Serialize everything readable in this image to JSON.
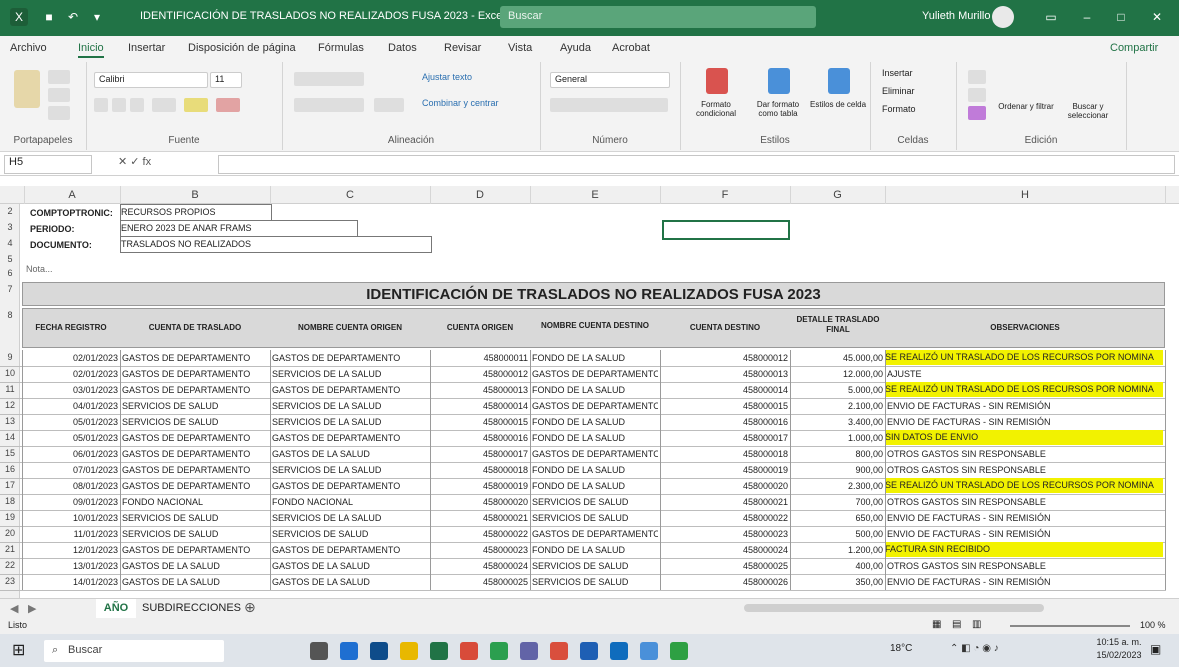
{
  "window": {
    "title": "IDENTIFICACIÓN DE TRASLADOS NO REALIZADOS FUSA 2023 - Excel",
    "search_placeholder": "Buscar",
    "user_name": "Yulieth Murillo"
  },
  "ribbon": {
    "tabs": [
      "Archivo",
      "Inicio",
      "Insertar",
      "Disposición de página",
      "Fórmulas",
      "Datos",
      "Revisar",
      "Vista",
      "Ayuda",
      "Acrobat"
    ],
    "share_label": "Compartir",
    "group_labels": [
      "Portapapeles",
      "Fuente",
      "Alineación",
      "Número",
      "Estilos",
      "Celdas",
      "Edición"
    ],
    "font_name": "Calibri",
    "font_size": "11",
    "number_format": "General",
    "wrap_label": "Ajustar texto",
    "merge_label": "Combinar y centrar",
    "style_buttons": [
      "Formato condicional",
      "Dar formato como tabla",
      "Estilos de celda"
    ],
    "cell_buttons": [
      "Insertar",
      "Eliminar",
      "Formato"
    ],
    "edit_buttons": [
      "Ordenar y filtrar",
      "Buscar y seleccionar"
    ]
  },
  "formula_bar": {
    "name_box": "H5",
    "content": ""
  },
  "columns": [
    "A",
    "B",
    "C",
    "D",
    "E",
    "F",
    "G",
    "H"
  ],
  "sheet": {
    "header_block": [
      {
        "label": "COMPTOPTRONIC:",
        "value": "RECURSOS PROPIOS"
      },
      {
        "label": "PERIODO:",
        "value": "ENERO 2023 DE ANAR FRAMS"
      },
      {
        "label": "DOCUMENTO:",
        "value": "TRASLADOS NO REALIZADOS"
      }
    ],
    "note": "Nota...",
    "main_title": "IDENTIFICACIÓN DE TRASLADOS NO REALIZADOS FUSA 2023",
    "table_headers": [
      "FECHA REGISTRO",
      "CUENTA DE TRASLADO",
      "NOMBRE CUENTA ORIGEN",
      "CUENTA ORIGEN",
      "NOMBRE CUENTA DESTINO",
      "CUENTA DESTINO",
      "DETALLE TRASLADO FINAL",
      "OBSERVACIONES"
    ],
    "rows": [
      {
        "d": "02/01/2023",
        "b": "GASTOS DE DEPARTAMENTO",
        "c": "GASTOS DE DEPARTAMENTO",
        "e": "458000011",
        "f": "FONDO DE LA SALUD",
        "g": "458000012",
        "h": "45.000,00",
        "obs": "SE REALIZÓ UN TRASLADO DE LOS RECURSOS POR NOMINA",
        "hl": true
      },
      {
        "d": "02/01/2023",
        "b": "GASTOS DE DEPARTAMENTO",
        "c": "SERVICIOS DE LA SALUD",
        "e": "458000012",
        "f": "GASTOS DE DEPARTAMENTO",
        "g": "458000013",
        "h": "12.000,00",
        "obs": "AJUSTE",
        "hl": false
      },
      {
        "d": "03/01/2023",
        "b": "GASTOS DE DEPARTAMENTO",
        "c": "GASTOS DE DEPARTAMENTO",
        "e": "458000013",
        "f": "FONDO DE LA SALUD",
        "g": "458000014",
        "h": "5.000,00",
        "obs": "SE REALIZÓ UN TRASLADO DE LOS RECURSOS POR NOMINA",
        "hl": true
      },
      {
        "d": "04/01/2023",
        "b": "SERVICIOS DE SALUD",
        "c": "SERVICIOS DE LA SALUD",
        "e": "458000014",
        "f": "GASTOS DE DEPARTAMENTO",
        "g": "458000015",
        "h": "2.100,00",
        "obs": "ENVIO DE FACTURAS - SIN REMISIÓN",
        "hl": false
      },
      {
        "d": "05/01/2023",
        "b": "SERVICIOS DE SALUD",
        "c": "SERVICIOS DE LA SALUD",
        "e": "458000015",
        "f": "FONDO DE LA SALUD",
        "g": "458000016",
        "h": "3.400,00",
        "obs": "ENVIO DE FACTURAS - SIN REMISIÓN",
        "hl": false
      },
      {
        "d": "05/01/2023",
        "b": "GASTOS DE DEPARTAMENTO",
        "c": "GASTOS DE DEPARTAMENTO",
        "e": "458000016",
        "f": "FONDO DE LA SALUD",
        "g": "458000017",
        "h": "1.000,00",
        "obs": "SIN DATOS DE ENVIO",
        "hl": true
      },
      {
        "d": "06/01/2023",
        "b": "GASTOS DE DEPARTAMENTO",
        "c": "GASTOS DE LA SALUD",
        "e": "458000017",
        "f": "GASTOS DE DEPARTAMENTO",
        "g": "458000018",
        "h": "800,00",
        "obs": "OTROS GASTOS SIN RESPONSABLE",
        "hl": false
      },
      {
        "d": "07/01/2023",
        "b": "GASTOS DE DEPARTAMENTO",
        "c": "SERVICIOS DE LA SALUD",
        "e": "458000018",
        "f": "FONDO DE LA SALUD",
        "g": "458000019",
        "h": "900,00",
        "obs": "OTROS GASTOS SIN RESPONSABLE",
        "hl": false
      },
      {
        "d": "08/01/2023",
        "b": "GASTOS DE DEPARTAMENTO",
        "c": "GASTOS DE DEPARTAMENTO",
        "e": "458000019",
        "f": "FONDO DE LA SALUD",
        "g": "458000020",
        "h": "2.300,00",
        "obs": "SE REALIZÓ UN TRASLADO DE LOS RECURSOS POR NOMINA",
        "hl": true
      },
      {
        "d": "09/01/2023",
        "b": "FONDO NACIONAL",
        "c": "FONDO NACIONAL",
        "e": "458000020",
        "f": "SERVICIOS DE SALUD",
        "g": "458000021",
        "h": "700,00",
        "obs": "OTROS GASTOS SIN RESPONSABLE",
        "hl": false
      },
      {
        "d": "10/01/2023",
        "b": "SERVICIOS DE SALUD",
        "c": "SERVICIOS DE LA SALUD",
        "e": "458000021",
        "f": "SERVICIOS DE SALUD",
        "g": "458000022",
        "h": "650,00",
        "obs": "ENVIO DE FACTURAS - SIN REMISIÓN",
        "hl": false
      },
      {
        "d": "11/01/2023",
        "b": "SERVICIOS DE SALUD",
        "c": "SERVICIOS DE SALUD",
        "e": "458000022",
        "f": "GASTOS DE DEPARTAMENTO",
        "g": "458000023",
        "h": "500,00",
        "obs": "ENVIO DE FACTURAS - SIN REMISIÓN",
        "hl": false
      },
      {
        "d": "12/01/2023",
        "b": "GASTOS DE DEPARTAMENTO",
        "c": "GASTOS DE DEPARTAMENTO",
        "e": "458000023",
        "f": "FONDO DE LA SALUD",
        "g": "458000024",
        "h": "1.200,00",
        "obs": "FACTURA SIN RECIBIDO",
        "hl": true
      },
      {
        "d": "13/01/2023",
        "b": "GASTOS DE LA SALUD",
        "c": "GASTOS DE LA SALUD",
        "e": "458000024",
        "f": "SERVICIOS DE SALUD",
        "g": "458000025",
        "h": "400,00",
        "obs": "OTROS GASTOS SIN RESPONSABLE",
        "hl": false
      },
      {
        "d": "14/01/2023",
        "b": "GASTOS DE LA SALUD",
        "c": "GASTOS DE LA SALUD",
        "e": "458000025",
        "f": "SERVICIOS DE SALUD",
        "g": "458000026",
        "h": "350,00",
        "obs": "ENVIO DE FACTURAS - SIN REMISIÓN",
        "hl": false
      }
    ]
  },
  "sheet_tabs": [
    "AÑO",
    "SUBDIRECCIONES"
  ],
  "status": {
    "ready": "Listo",
    "zoom": "100 %"
  },
  "taskbar": {
    "search_label": "Buscar",
    "weather": "18°C",
    "time": "10:15 a. m.",
    "date": "15/02/2023"
  },
  "colors": {
    "excel_green": "#217346",
    "highlight_yellow": "#f2f200"
  }
}
